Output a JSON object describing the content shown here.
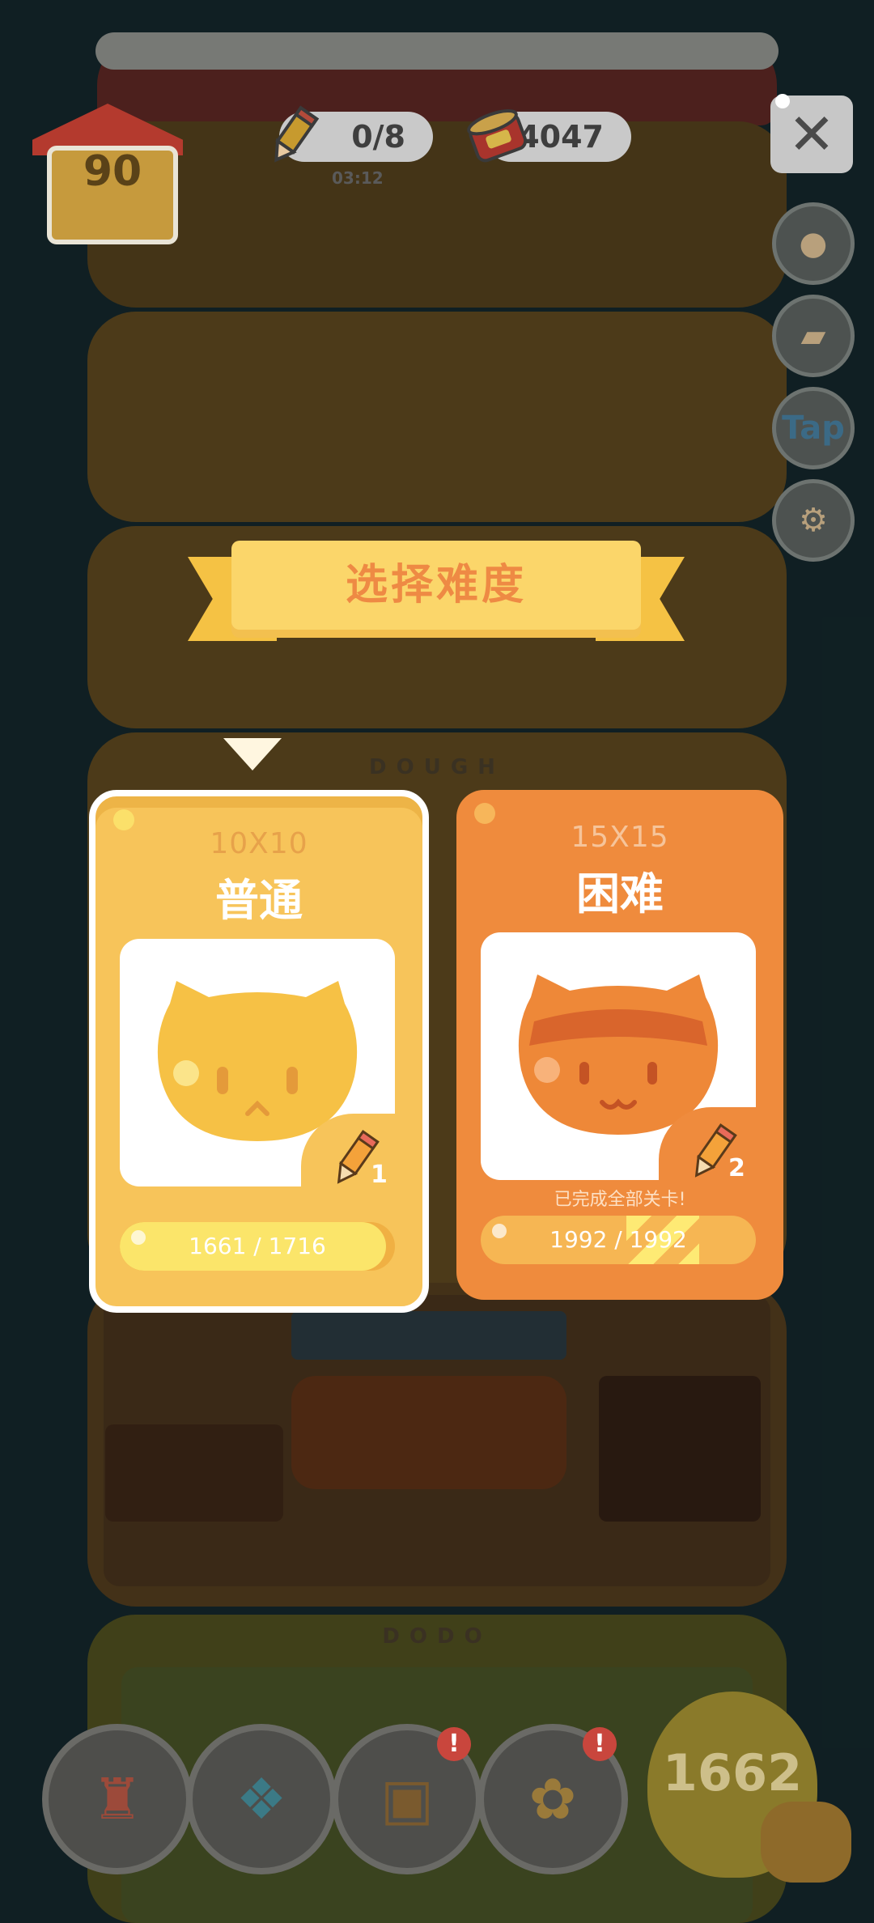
{
  "hud": {
    "house_level": "90",
    "pencils": "0/8",
    "timer": "03:12",
    "cans": "4047"
  },
  "side_buttons": [
    "mushroom",
    "brush",
    "Tap",
    "gear"
  ],
  "scene": {
    "floor_label_dough": "DOUGH",
    "floor_label_dodo": "DODO"
  },
  "dialog": {
    "title": "选择难度",
    "cards": [
      {
        "size": "10X10",
        "name": "普通",
        "pencil_cost": "1",
        "progress_text": "1661 / 1716",
        "progress_fraction": 0.968,
        "selected": true,
        "note": ""
      },
      {
        "size": "15X15",
        "name": "困难",
        "pencil_cost": "2",
        "progress_text": "1992 / 1992",
        "progress_fraction": 1.0,
        "selected": false,
        "note": "已完成全部关卡!"
      }
    ]
  },
  "bottom": {
    "coins": "1662"
  },
  "colors": {
    "normal_card": "#f7c45a",
    "hard_card": "#ef8b3d",
    "title_text": "#ee8a44"
  }
}
